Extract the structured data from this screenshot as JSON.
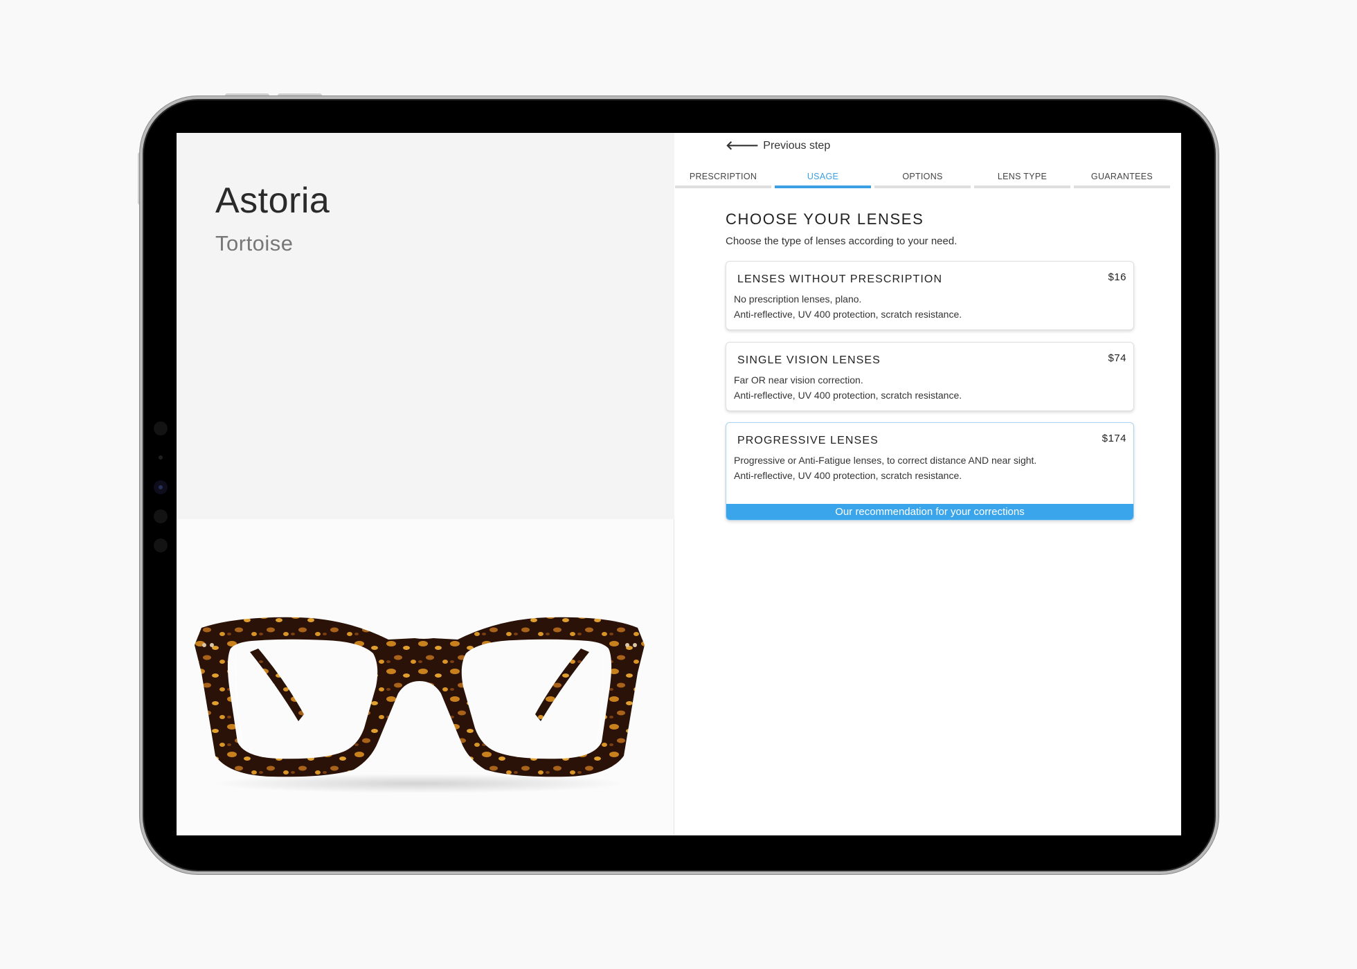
{
  "product": {
    "name": "Astoria",
    "color": "Tortoise"
  },
  "nav": {
    "previous_step": "Previous step"
  },
  "tabs": [
    {
      "label": "PRESCRIPTION",
      "active": false
    },
    {
      "label": "USAGE",
      "active": true
    },
    {
      "label": "OPTIONS",
      "active": false
    },
    {
      "label": "LENS TYPE",
      "active": false
    },
    {
      "label": "GUARANTEES",
      "active": false
    }
  ],
  "section": {
    "title": "CHOOSE YOUR LENSES",
    "subtitle": "Choose the type of lenses according to your need."
  },
  "options": [
    {
      "title": "LENSES WITHOUT PRESCRIPTION",
      "price": "$16",
      "line1": "No prescription lenses, plano.",
      "line2": "Anti-reflective, UV 400 protection, scratch resistance."
    },
    {
      "title": "SINGLE VISION LENSES",
      "price": "$74",
      "line1": "Far OR near vision correction.",
      "line2": "Anti-reflective, UV 400 protection, scratch resistance."
    },
    {
      "title": "PROGRESSIVE LENSES",
      "price": "$174",
      "line1": "Progressive or Anti-Fatigue lenses, to correct distance AND near sight.",
      "line2": "Anti-reflective, UV 400 protection, scratch resistance.",
      "banner": "Our recommendation for your corrections"
    }
  ],
  "colors": {
    "accent": "#3a9fe3",
    "banner": "#3aa5ea",
    "frame_dark": "#2a1208",
    "frame_amber": "#c8811c"
  }
}
